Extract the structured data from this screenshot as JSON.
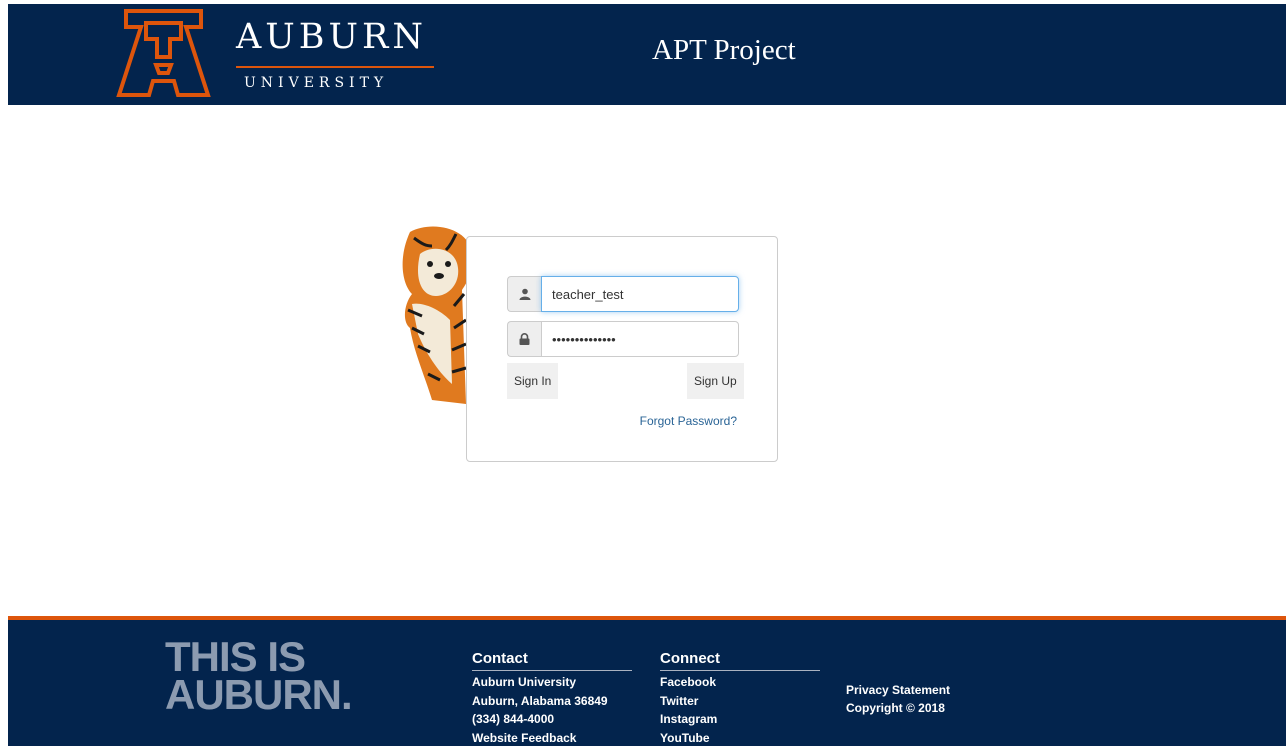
{
  "header": {
    "logo_word": "AUBURN",
    "logo_sub": "UNIVERSITY",
    "site_title": "APT Project"
  },
  "login": {
    "username_value": "teacher_test",
    "password_value": "••••••••••••••",
    "sign_in_label": "Sign In",
    "sign_up_label": "Sign Up",
    "forgot_label": "Forgot Password?"
  },
  "icons": {
    "username": "user-icon",
    "password": "lock-icon"
  },
  "footer": {
    "tagline_line1": "THIS IS",
    "tagline_line2": "AUBURN.",
    "contact": {
      "heading": "Contact",
      "items": [
        "Auburn University",
        "Auburn, Alabama 36849",
        "(334) 844-4000",
        "Website Feedback"
      ]
    },
    "connect": {
      "heading": "Connect",
      "items": [
        "Facebook",
        "Twitter",
        "Instagram",
        "YouTube"
      ]
    },
    "privacy": "Privacy Statement",
    "copyright": "Copyright © 2018"
  },
  "colors": {
    "navy": "#03244d",
    "orange": "#dd550c",
    "link": "#2a6496"
  }
}
